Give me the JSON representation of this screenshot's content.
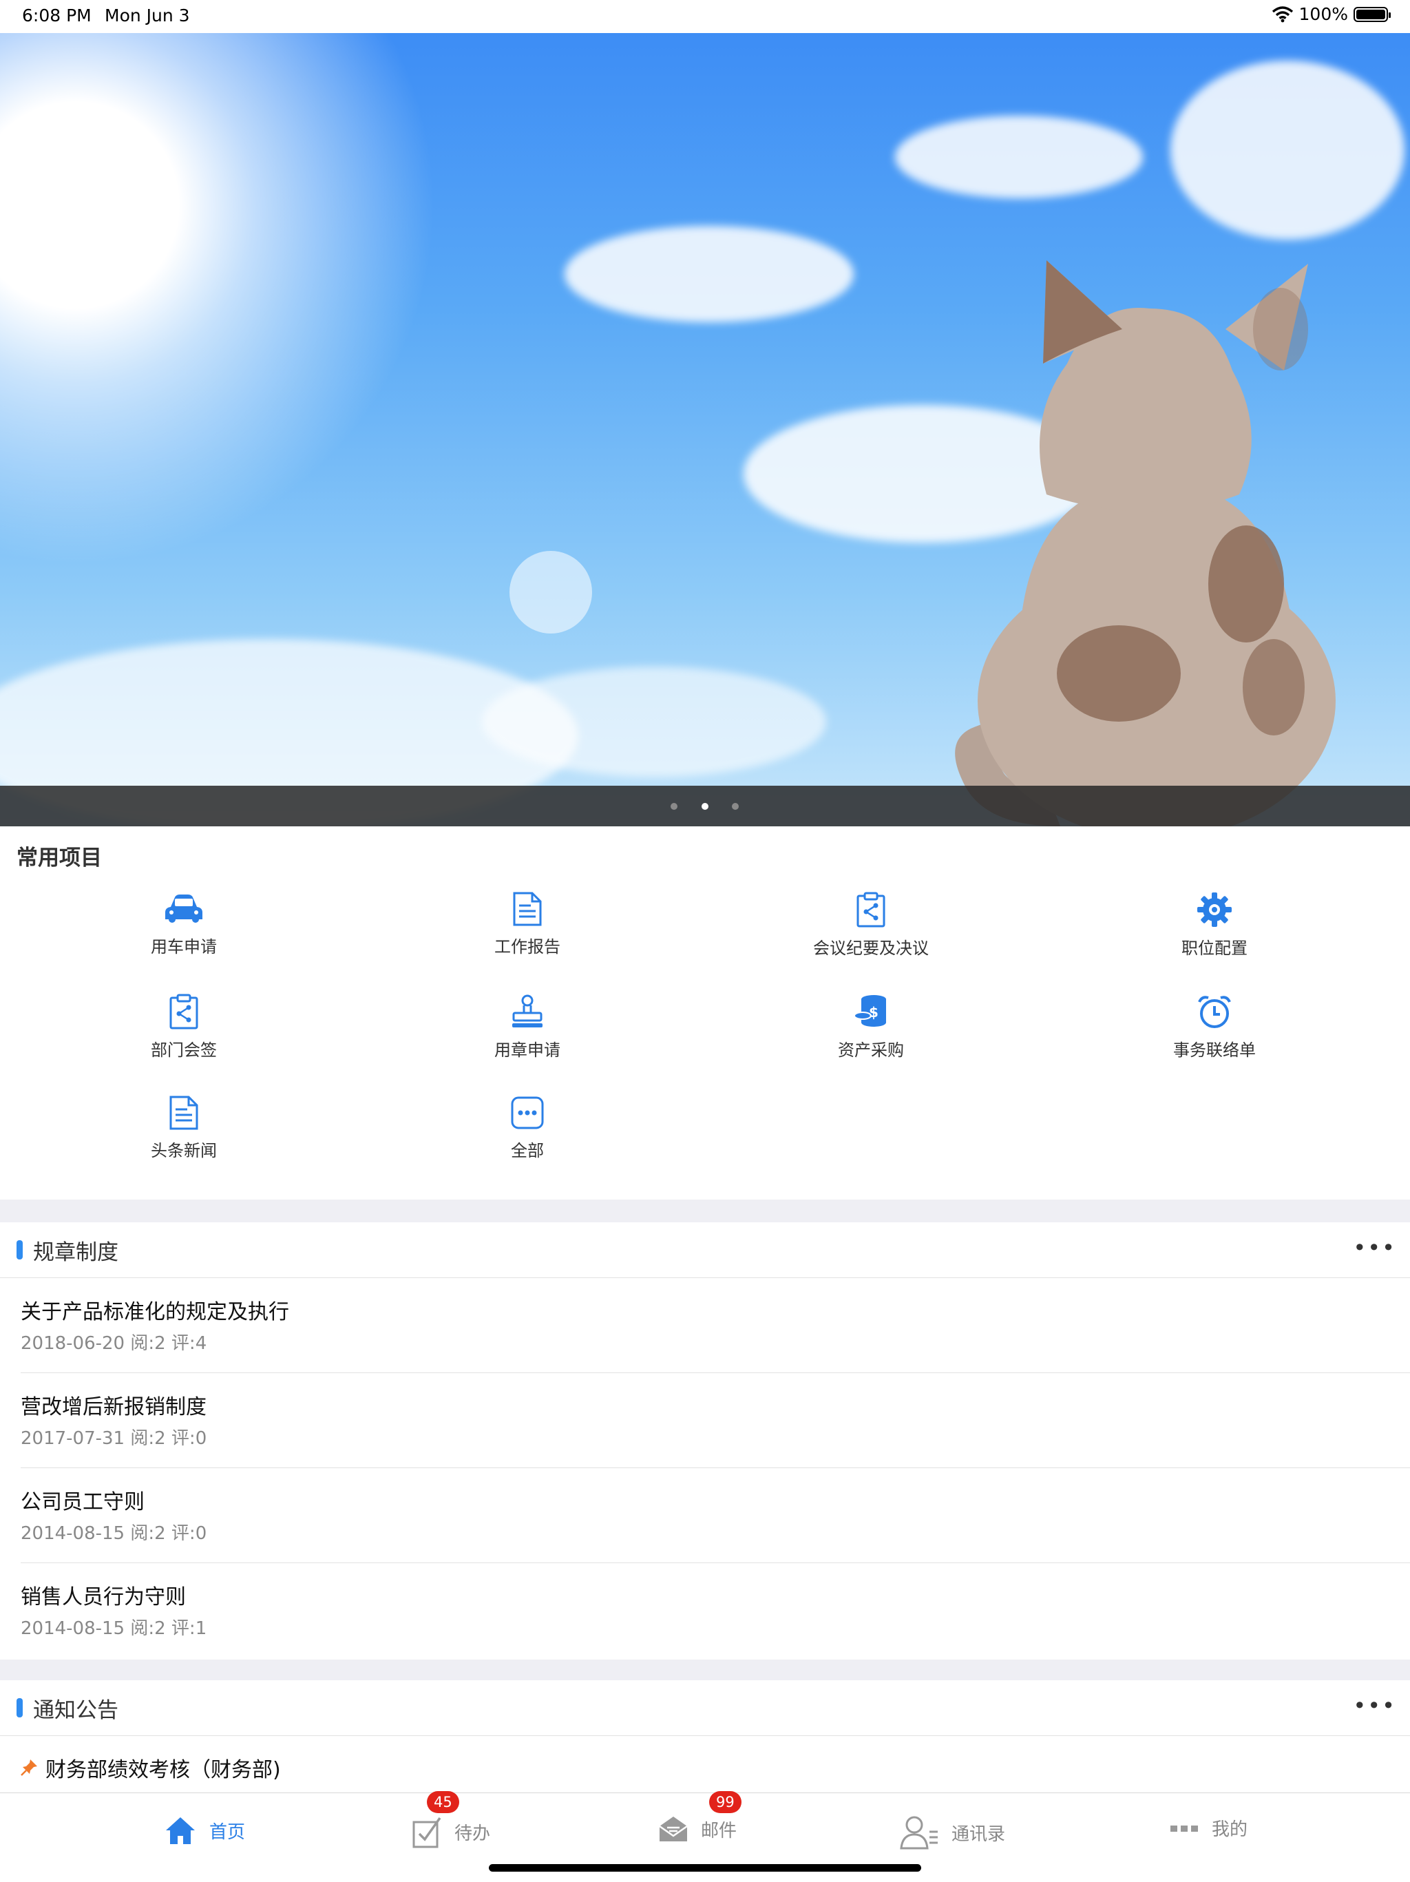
{
  "status_bar": {
    "time": "6:08 PM",
    "date": "Mon Jun 3",
    "battery": "100%"
  },
  "banner": {
    "page_count": 3,
    "active_page": 2
  },
  "common": {
    "title": "常用项目",
    "items": [
      {
        "label": "用车申请",
        "icon": "car-icon"
      },
      {
        "label": "工作报告",
        "icon": "document-icon"
      },
      {
        "label": "会议纪要及决议",
        "icon": "clipboard-share-icon"
      },
      {
        "label": "职位配置",
        "icon": "gear-icon"
      },
      {
        "label": "部门会签",
        "icon": "clipboard-share-icon"
      },
      {
        "label": "用章申请",
        "icon": "stamp-icon"
      },
      {
        "label": "资产采购",
        "icon": "coins-icon"
      },
      {
        "label": "事务联络单",
        "icon": "alarm-clock-icon"
      },
      {
        "label": "头条新闻",
        "icon": "document-icon"
      },
      {
        "label": "全部",
        "icon": "more-icon"
      }
    ]
  },
  "regulations": {
    "title": "规章制度",
    "more": "•••",
    "items": [
      {
        "title": "关于产品标准化的规定及执行",
        "meta": "2018-06-20 阅:2 评:4"
      },
      {
        "title": "营改增后新报销制度",
        "meta": "2017-07-31 阅:2 评:0"
      },
      {
        "title": "公司员工守则",
        "meta": "2014-08-15 阅:2 评:0"
      },
      {
        "title": "销售人员行为守则",
        "meta": "2014-08-15 阅:2 评:1"
      }
    ]
  },
  "notices": {
    "title": "通知公告",
    "more": "•••",
    "items": [
      {
        "title": "财务部绩效考核（财务部)",
        "pinned": true
      }
    ]
  },
  "tabbar": {
    "tabs": [
      {
        "label": "首页",
        "icon": "home-icon",
        "active": true
      },
      {
        "label": "待办",
        "icon": "todo-icon",
        "badge": "45"
      },
      {
        "label": "邮件",
        "icon": "mail-icon",
        "badge": "99"
      },
      {
        "label": "通讯录",
        "icon": "contacts-icon"
      },
      {
        "label": "我的",
        "icon": "more-dots-icon"
      }
    ]
  },
  "colors": {
    "accent": "#2f8cf0",
    "badge": "#e2231a",
    "icon_blue": "#2a7fe6"
  }
}
